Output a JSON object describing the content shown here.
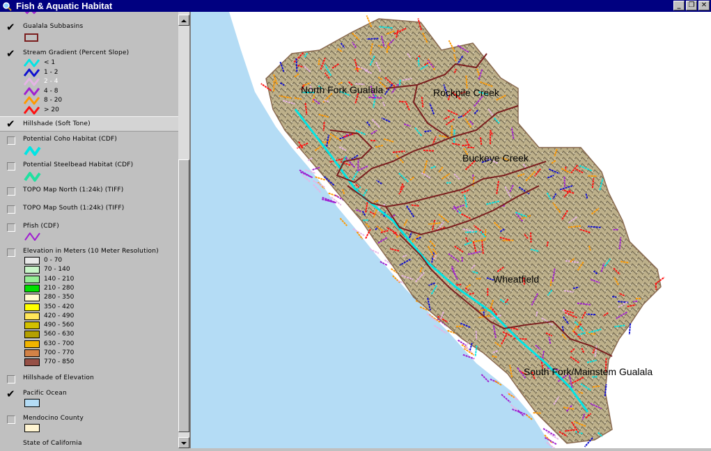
{
  "window": {
    "title": "Fish & Aquatic Habitat",
    "icon": "magnifier-icon",
    "controls": [
      "minimize",
      "maximize",
      "close"
    ],
    "control_glyphs": [
      "_",
      "❐",
      "✕"
    ]
  },
  "legend": {
    "subbasins": {
      "label": "Gualala Subbasins",
      "checked": true,
      "outline_color": "#7a1e1e"
    },
    "gradient": {
      "label": "Stream Gradient (Percent Slope)",
      "checked": true,
      "classes": [
        {
          "label": "< 1",
          "color": "#00e5e5"
        },
        {
          "label": "1 - 2",
          "color": "#1010d0"
        },
        {
          "label": "2 - 4",
          "color": "#e6b4e6"
        },
        {
          "label": "4 - 8",
          "color": "#a020d0"
        },
        {
          "label": "8 - 20",
          "color": "#ff9900"
        },
        {
          "label": "> 20",
          "color": "#ff1010"
        }
      ]
    },
    "hillshade_soft": {
      "label": "Hillshade (Soft Tone)",
      "checked": true
    },
    "coho": {
      "label": "Potential Coho Habitat (CDF)",
      "checked": false,
      "color": "#00e5e5"
    },
    "steelhead": {
      "label": "Potential Steelbead Habitat (CDF)",
      "checked": false,
      "color": "#20e0a0"
    },
    "topo_north": {
      "label": "TOPO Map North (1:24k) (TIFF)",
      "checked": false
    },
    "topo_south": {
      "label": "TOPO Map South (1:24k) (TIFF)",
      "checked": false
    },
    "pfish": {
      "label": "Pfish (CDF)",
      "checked": false,
      "color": "#a020d0"
    },
    "elevation": {
      "label": "Elevation in Meters (10 Meter Resolution)",
      "checked": false,
      "classes": [
        {
          "label": "0 - 70",
          "color": "#e8e8e8"
        },
        {
          "label": "70 - 140",
          "color": "#c8f5c8"
        },
        {
          "label": "140 - 210",
          "color": "#96ee96"
        },
        {
          "label": "210 - 280",
          "color": "#00e000"
        },
        {
          "label": "280 - 350",
          "color": "#fffad2"
        },
        {
          "label": "350 - 420",
          "color": "#ffff00"
        },
        {
          "label": "420 - 490",
          "color": "#ffe65a"
        },
        {
          "label": "490 - 560",
          "color": "#d2c000"
        },
        {
          "label": "560 - 630",
          "color": "#b4a000"
        },
        {
          "label": "630 - 700",
          "color": "#f0b400"
        },
        {
          "label": "700 - 770",
          "color": "#d28246"
        },
        {
          "label": "770 - 850",
          "color": "#965046"
        }
      ]
    },
    "hillshade_elev": {
      "label": "Hillshade of Elevation",
      "checked": false
    },
    "ocean": {
      "label": "Pacific Ocean",
      "checked": true,
      "color": "#b4dcf5"
    },
    "mendocino": {
      "label": "Mendocino County",
      "checked": false,
      "color": "#fff5d2"
    },
    "california": {
      "label": "State of California",
      "checked": false
    }
  },
  "scrollbar": {
    "up_icon": "scroll-up-arrow-icon",
    "down_icon": "scroll-down-arrow-icon"
  },
  "map": {
    "subbasin_labels": [
      "North Fork Gualala",
      "Rockpile Creek",
      "Buckeye Creek",
      "Wheatfield",
      "South Fork/Mainstem Gualala"
    ],
    "colors": {
      "ocean": "#b4dcf5",
      "land": "#ffffff",
      "terrain": "#bdb08a",
      "boundary": "#7a1e1e"
    }
  }
}
